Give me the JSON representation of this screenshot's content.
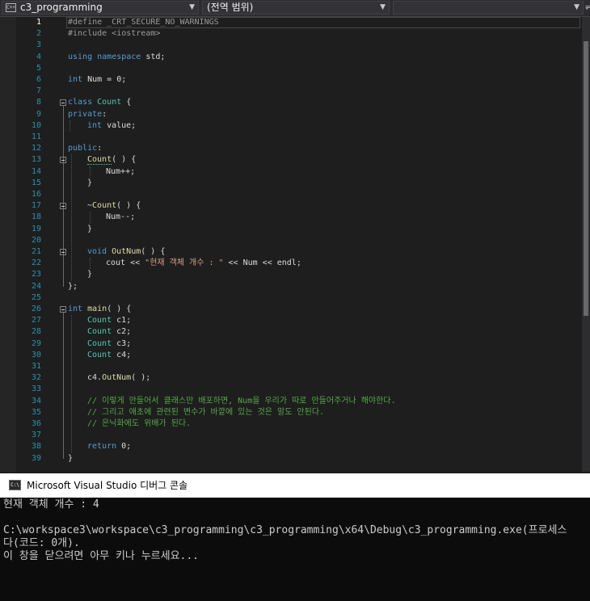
{
  "navbar": {
    "project": "c3_programming",
    "scope": "(전역 범위)",
    "member": "",
    "project_icon": "C++",
    "split": "⇌"
  },
  "editor": {
    "current_line": 1,
    "lines": [
      [
        {
          "t": "#define _CRT_SECURE_NO_WARNINGS",
          "c": "pp"
        }
      ],
      [
        {
          "t": "#include <iostream>",
          "c": "pp"
        }
      ],
      [],
      [
        {
          "t": "using",
          "c": "kw"
        },
        {
          "t": " ",
          "c": "id"
        },
        {
          "t": "namespace",
          "c": "kw"
        },
        {
          "t": " std;",
          "c": "id"
        }
      ],
      [],
      [
        {
          "t": "int",
          "c": "kw"
        },
        {
          "t": " Num = 0;",
          "c": "id"
        }
      ],
      [],
      [
        {
          "t": "class",
          "c": "kw"
        },
        {
          "t": " ",
          "c": "id"
        },
        {
          "t": "Count",
          "c": "ty"
        },
        {
          "t": " {",
          "c": "id"
        }
      ],
      [
        {
          "t": "private",
          "c": "kw"
        },
        {
          "t": ":",
          "c": "id"
        }
      ],
      [
        {
          "t": "int",
          "c": "kw"
        },
        {
          "t": " value;",
          "c": "id"
        }
      ],
      [],
      [
        {
          "t": "public",
          "c": "kw"
        },
        {
          "t": ":",
          "c": "id"
        }
      ],
      [
        {
          "t": "Count",
          "c": "fn sq"
        },
        {
          "t": "( ) {",
          "c": "id"
        }
      ],
      [
        {
          "t": "Num++;",
          "c": "id"
        }
      ],
      [
        {
          "t": "}",
          "c": "id"
        }
      ],
      [],
      [
        {
          "t": "~",
          "c": "id"
        },
        {
          "t": "Count",
          "c": "fn"
        },
        {
          "t": "( ) {",
          "c": "id"
        }
      ],
      [
        {
          "t": "Num--;",
          "c": "id"
        }
      ],
      [
        {
          "t": "}",
          "c": "id"
        }
      ],
      [],
      [
        {
          "t": "void",
          "c": "kw"
        },
        {
          "t": " ",
          "c": "id"
        },
        {
          "t": "OutNum",
          "c": "fn"
        },
        {
          "t": "( ) {",
          "c": "id"
        }
      ],
      [
        {
          "t": "cout << ",
          "c": "id"
        },
        {
          "t": "\"현재 객체 개수 : \"",
          "c": "str"
        },
        {
          "t": " << Num << endl;",
          "c": "id"
        }
      ],
      [
        {
          "t": "}",
          "c": "id"
        }
      ],
      [
        {
          "t": "};",
          "c": "id"
        }
      ],
      [],
      [
        {
          "t": "int",
          "c": "kw"
        },
        {
          "t": " ",
          "c": "id"
        },
        {
          "t": "main",
          "c": "fn"
        },
        {
          "t": "( ) {",
          "c": "id"
        }
      ],
      [
        {
          "t": "Count",
          "c": "ty"
        },
        {
          "t": " c1;",
          "c": "id"
        }
      ],
      [
        {
          "t": "Count",
          "c": "ty"
        },
        {
          "t": " c2;",
          "c": "id"
        }
      ],
      [
        {
          "t": "Count",
          "c": "ty"
        },
        {
          "t": " c3;",
          "c": "id"
        }
      ],
      [
        {
          "t": "Count",
          "c": "ty"
        },
        {
          "t": " c4;",
          "c": "id"
        }
      ],
      [],
      [
        {
          "t": "c4.",
          "c": "id"
        },
        {
          "t": "OutNum",
          "c": "fn"
        },
        {
          "t": "( );",
          "c": "id"
        }
      ],
      [],
      [
        {
          "t": "// 이렇게 만들어서 클래스만 배포하면, Num을 우리가 따로 만들어주거나 해야한다.",
          "c": "cm"
        }
      ],
      [
        {
          "t": "// 그리고 애초에 관련된 변수가 바깥에 있는 것은 말도 안된다.",
          "c": "cm"
        }
      ],
      [
        {
          "t": "// 은닉화에도 위배가 된다.",
          "c": "cm"
        }
      ],
      [],
      [
        {
          "t": "return",
          "c": "kw"
        },
        {
          "t": " 0;",
          "c": "id"
        }
      ],
      [
        {
          "t": "}",
          "c": "id"
        }
      ]
    ]
  },
  "console": {
    "icon": "C:\\",
    "title": "Microsoft Visual Studio 디버그 콘솔",
    "lines": [
      "현재 객체 개수 : 4",
      "",
      "C:\\workspace3\\workspace\\c3_programming\\c3_programming\\x64\\Debug\\c3_programming.exe(프로세스",
      "다(코드: 0개).",
      "이 창을 닫으려면 아무 키나 누르세요..."
    ]
  }
}
